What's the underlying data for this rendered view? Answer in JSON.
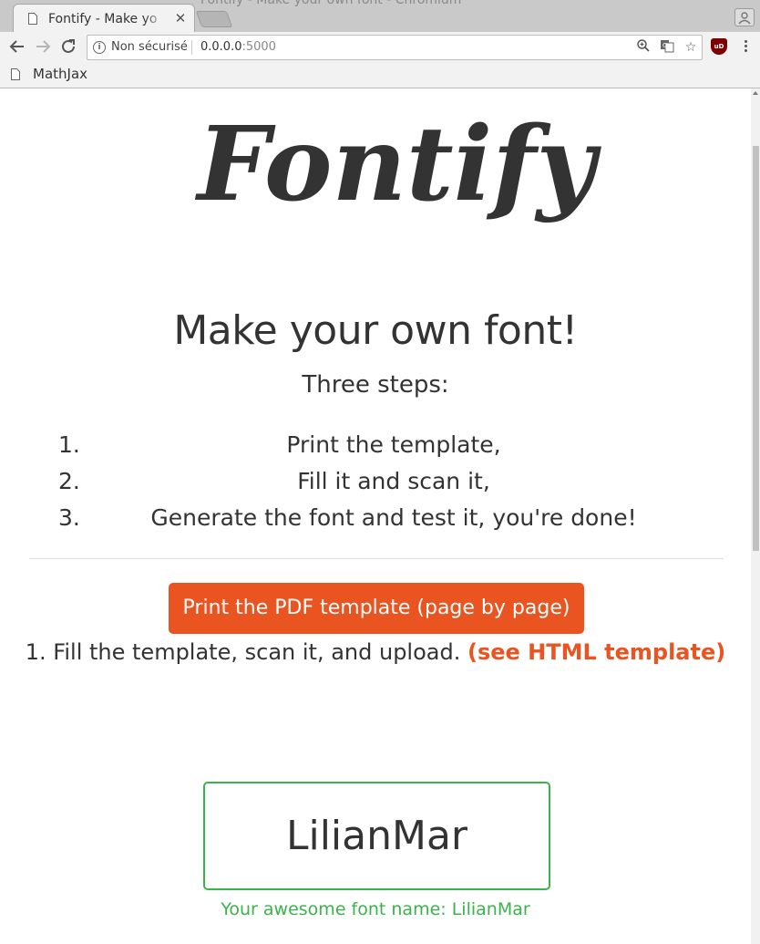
{
  "browser": {
    "window_title": "Fontify - Make your own font - Chromium",
    "tab_title": "Fontify - Make yo",
    "security_label": "Non sécurisé",
    "url_host": "0.0.0.0",
    "url_port": ":5000",
    "bookmarks": [
      {
        "label": "MathJax"
      }
    ],
    "icons": [
      "page-icon",
      "close-icon",
      "back-arrow-icon",
      "forward-arrow-icon",
      "reload-icon",
      "info-icon",
      "zoom-icon",
      "translate-icon",
      "star-icon",
      "ublock-icon",
      "menu-icon",
      "profile-icon"
    ]
  },
  "page": {
    "logo_text": "Fontify",
    "title": "Make your own font!",
    "subtitle": "Three steps:",
    "steps": [
      {
        "number": "1.",
        "text": "Print the template,"
      },
      {
        "number": "2.",
        "text": "Fill it and scan it,"
      },
      {
        "number": "3.",
        "text": "Generate the font and test it, you're done!"
      }
    ],
    "print_button_label": "Print the PDF template (page by page)",
    "fill_instruction": "1. Fill the template, scan it, and upload.",
    "html_template_link": "(see HTML template)",
    "font_name_value": "LilianMar",
    "font_name_caption": "Your awesome font name: LilianMar"
  },
  "colors": {
    "accent": "#e95420",
    "success": "#38b44a",
    "text": "#333333"
  }
}
